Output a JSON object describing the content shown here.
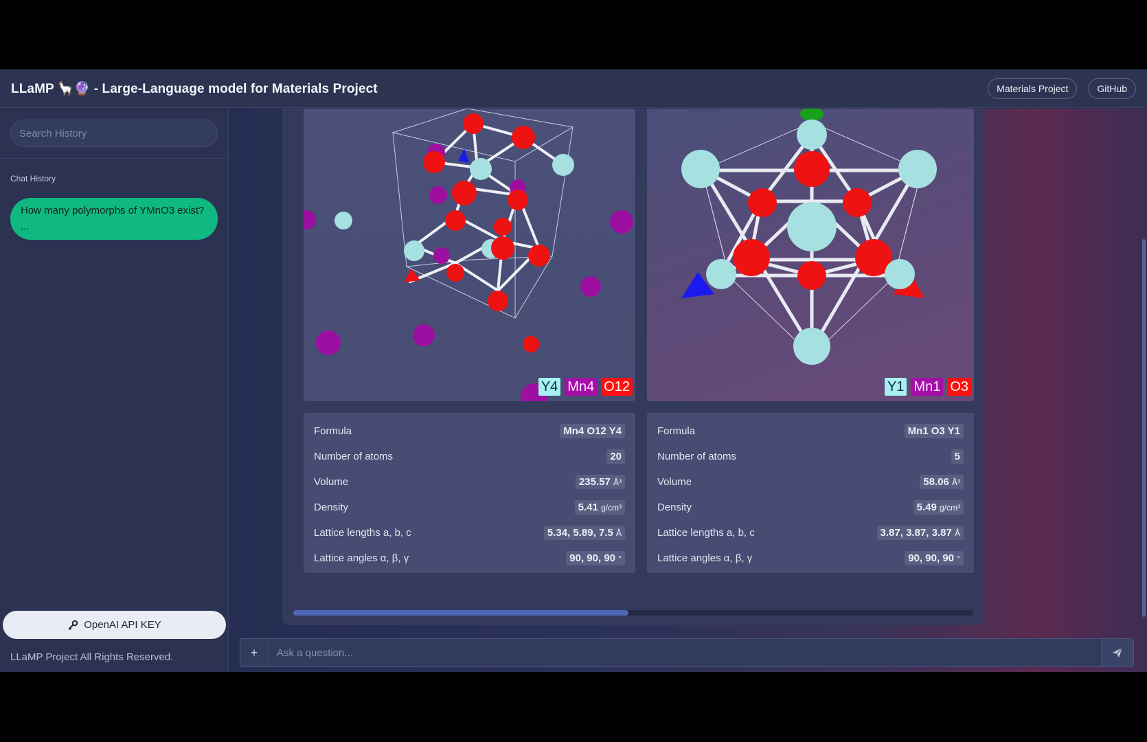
{
  "header": {
    "title": "LLaMP 🦙🔮 - Large-Language model for Materials Project",
    "buttons": [
      "Materials Project",
      "GitHub"
    ]
  },
  "sidebar": {
    "search_placeholder": "Search History",
    "section_label": "Chat History",
    "history": [
      "How many polymorphs of YMnO3 exist? ..."
    ],
    "api_key_button": "OpenAI API KEY",
    "footer": "LLaMP Project All Rights Reserved."
  },
  "structures": [
    {
      "badges": {
        "y": "Y4",
        "mn": "Mn4",
        "o": "O12"
      },
      "properties": [
        {
          "label": "Formula",
          "value": "Mn4 O12 Y4",
          "unit": ""
        },
        {
          "label": "Number of atoms",
          "value": "20",
          "unit": ""
        },
        {
          "label": "Volume",
          "value": "235.57",
          "unit": "Å³"
        },
        {
          "label": "Density",
          "value": "5.41",
          "unit": "g/cm³"
        },
        {
          "label": "Lattice lengths a, b, c",
          "value": "5.34, 5.89, 7.5",
          "unit": "Å"
        },
        {
          "label": "Lattice angles α, β, γ",
          "value": "90, 90, 90",
          "unit": "°"
        }
      ]
    },
    {
      "badges": {
        "y": "Y1",
        "mn": "Mn1",
        "o": "O3"
      },
      "properties": [
        {
          "label": "Formula",
          "value": "Mn1 O3 Y1",
          "unit": ""
        },
        {
          "label": "Number of atoms",
          "value": "5",
          "unit": ""
        },
        {
          "label": "Volume",
          "value": "58.06",
          "unit": "Å³"
        },
        {
          "label": "Density",
          "value": "5.49",
          "unit": "g/cm³"
        },
        {
          "label": "Lattice lengths a, b, c",
          "value": "3.87, 3.87, 3.87",
          "unit": "Å"
        },
        {
          "label": "Lattice angles α, β, γ",
          "value": "90, 90, 90",
          "unit": "°"
        }
      ]
    }
  ],
  "input": {
    "placeholder": "Ask a question...",
    "plus_label": "+"
  },
  "colors": {
    "y_atom": "#a6e0e0",
    "mn_atom": "#9c0fa0",
    "o_atom": "#ee1212",
    "history_bubble": "#10b981"
  },
  "icons": [
    "key-icon",
    "plus-icon",
    "send-icon",
    "mouse-cursor-icon"
  ]
}
